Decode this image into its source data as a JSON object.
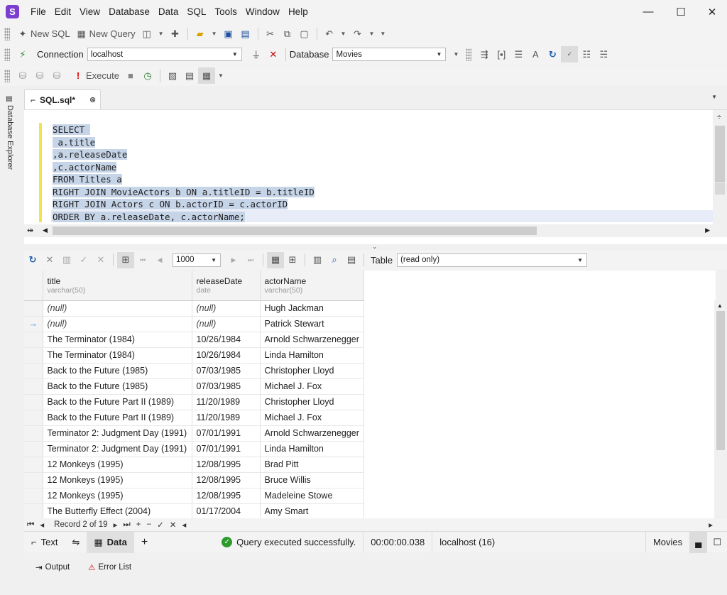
{
  "menu": {
    "logo": "S",
    "items": [
      "File",
      "Edit",
      "View",
      "Database",
      "Data",
      "SQL",
      "Tools",
      "Window",
      "Help"
    ]
  },
  "window_controls": {
    "minimize": "—",
    "maximize": "☐",
    "close": "✕"
  },
  "toolbar1": {
    "new_sql": "New SQL",
    "new_query": "New Query"
  },
  "toolbar2": {
    "connection_label": "Connection",
    "connection_value": "localhost",
    "database_label": "Database",
    "database_value": "Movies"
  },
  "toolbar3": {
    "execute": "Execute"
  },
  "sidebar": {
    "label": "Database Explorer"
  },
  "tab": {
    "title": "SQL.sql*"
  },
  "editor": {
    "lines": [
      "SELECT ",
      " a.title",
      ",a.releaseDate",
      ",c.actorName",
      "FROM Titles a",
      "RIGHT JOIN MovieActors b ON a.titleID = b.titleID",
      "RIGHT JOIN Actors c ON b.actorID = c.actorID",
      "ORDER BY a.releaseDate, c.actorName;"
    ]
  },
  "grid_toolbar": {
    "page_size": "1000",
    "table_label": "Table",
    "table_mode": "(read only)"
  },
  "grid": {
    "columns": [
      {
        "name": "title",
        "type": "varchar(50)"
      },
      {
        "name": "releaseDate",
        "type": "date"
      },
      {
        "name": "actorName",
        "type": "varchar(50)"
      }
    ],
    "rows": [
      [
        "(null)",
        "(null)",
        "Hugh Jackman"
      ],
      [
        "(null)",
        "(null)",
        "Patrick Stewart"
      ],
      [
        "The Terminator (1984)",
        "10/26/1984",
        "Arnold Schwarzenegger"
      ],
      [
        "The Terminator (1984)",
        "10/26/1984",
        "Linda Hamilton"
      ],
      [
        "Back to the Future (1985)",
        "07/03/1985",
        "Christopher Lloyd"
      ],
      [
        "Back to the Future (1985)",
        "07/03/1985",
        "Michael J. Fox"
      ],
      [
        "Back to the Future Part II (1989)",
        "11/20/1989",
        "Christopher Lloyd"
      ],
      [
        "Back to the Future Part II (1989)",
        "11/20/1989",
        "Michael J. Fox"
      ],
      [
        "Terminator 2: Judgment Day (1991)",
        "07/01/1991",
        "Arnold Schwarzenegger"
      ],
      [
        "Terminator 2: Judgment Day (1991)",
        "07/01/1991",
        "Linda Hamilton"
      ],
      [
        "12 Monkeys (1995)",
        "12/08/1995",
        "Brad Pitt"
      ],
      [
        "12 Monkeys (1995)",
        "12/08/1995",
        "Bruce Willis"
      ],
      [
        "12 Monkeys (1995)",
        "12/08/1995",
        "Madeleine Stowe"
      ],
      [
        "The Butterfly Effect (2004)",
        "01/17/2004",
        "Amy Smart"
      ]
    ],
    "current_row_marker": "→"
  },
  "navigator": {
    "record_text": "Record 2 of 19"
  },
  "statusbar": {
    "text_tab": "Text",
    "data_tab": "Data",
    "status_message": "Query executed successfully.",
    "elapsed": "00:00:00.038",
    "server": "localhost (16)",
    "database": "Movies"
  },
  "bottom": {
    "output": "Output",
    "error_list": "Error List"
  }
}
